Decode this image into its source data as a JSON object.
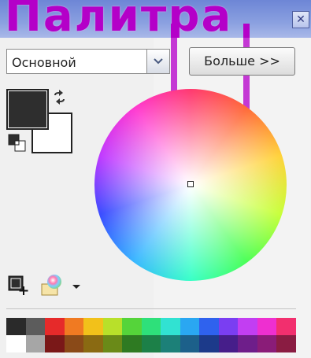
{
  "window": {
    "title": "Палитра",
    "close_glyph": "✕"
  },
  "preset": {
    "selected": "Основной"
  },
  "more_button": {
    "label": "Больше >>"
  },
  "colors": {
    "primary": "#2e2e2e",
    "secondary": "#ffffff"
  },
  "palette": {
    "row1": [
      "#2a2a2a",
      "#5c5c5c",
      "#e62a2a",
      "#f07a22",
      "#f2c11a",
      "#b8e02a",
      "#55d43a",
      "#2ee07a",
      "#31e2d2",
      "#2aa7f2",
      "#2f62ee",
      "#7a3ef2",
      "#c23ef2",
      "#ee2fd0",
      "#f22f6e"
    ],
    "row2": [
      "#ffffff",
      "#a6a6a6",
      "#7a1818",
      "#8a4a18",
      "#8a6a12",
      "#6a8a18",
      "#2e7a22",
      "#1c8048",
      "#1c8078",
      "#1c608a",
      "#1c3a8a",
      "#461e8a",
      "#6e1e8a",
      "#8a1c78",
      "#8a1c42"
    ]
  },
  "icons": {
    "swap": "swap-colors-icon",
    "reset": "reset-colors-icon",
    "add_color": "add-color-icon",
    "palette_menu": "palette-menu-icon",
    "dropdown": "chevron-down-icon"
  }
}
